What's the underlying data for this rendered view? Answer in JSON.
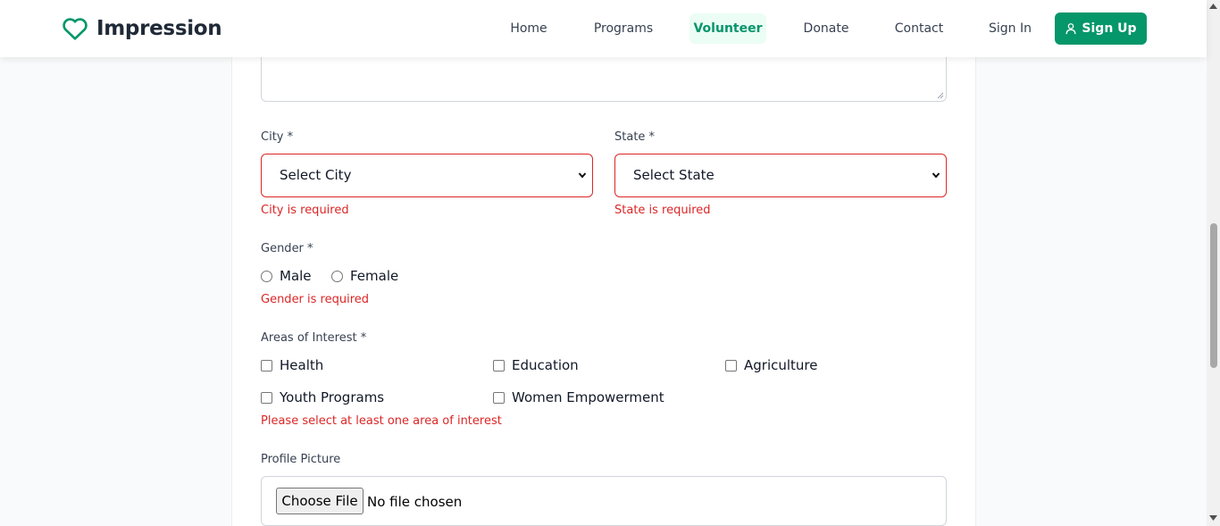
{
  "nav": {
    "brand": "Impression",
    "links": [
      "Home",
      "Programs",
      "Volunteer",
      "Donate",
      "Contact"
    ],
    "sign_in": "Sign In",
    "sign_up": "Sign Up",
    "active_link": "Volunteer"
  },
  "form": {
    "city": {
      "label": "City *",
      "value": "Select City",
      "error": "City is required"
    },
    "state": {
      "label": "State *",
      "value": "Select State",
      "error": "State is required"
    },
    "gender": {
      "label": "Gender *",
      "options": [
        "Male",
        "Female"
      ],
      "error": "Gender is required"
    },
    "interests": {
      "label": "Areas of Interest *",
      "options": [
        "Health",
        "Education",
        "Agriculture",
        "Youth Programs",
        "Women Empowerment"
      ],
      "error": "Please select at least one area of interest"
    },
    "profile_picture": {
      "label": "Profile Picture",
      "button": "Choose File",
      "status": "No file chosen"
    }
  },
  "colors": {
    "brand": "#059669",
    "error": "#dc2626",
    "active_bg": "#ecfdf5"
  },
  "icons": {
    "brand": "heart-icon",
    "sign_up": "user-icon"
  }
}
